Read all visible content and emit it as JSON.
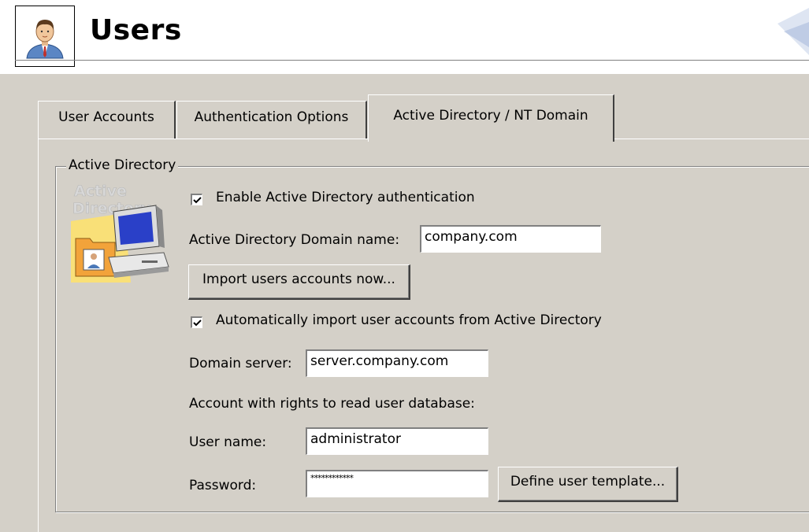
{
  "header": {
    "title": "Users",
    "icon": "user-icon"
  },
  "tabs": [
    {
      "label": "User Accounts",
      "active": false
    },
    {
      "label": "Authentication Options",
      "active": false
    },
    {
      "label": "Active Directory / NT Domain",
      "active": true
    }
  ],
  "active_directory": {
    "group_label": "Active Directory",
    "illustration_text": "Active Directory",
    "enable_checkbox": {
      "label": "Enable Active Directory authentication",
      "checked": true
    },
    "domain_name": {
      "label": "Active Directory Domain name:",
      "value": "company.com"
    },
    "import_button": "Import users accounts now...",
    "auto_import_checkbox": {
      "label": "Automatically import user accounts from Active Directory",
      "checked": true
    },
    "domain_server": {
      "label": "Domain server:",
      "value": "server.company.com"
    },
    "account_rights_label": "Account with rights to read user database:",
    "user_name": {
      "label": "User name:",
      "value": "administrator"
    },
    "password": {
      "label": "Password:",
      "value": "************"
    },
    "template_button": "Define user template..."
  }
}
